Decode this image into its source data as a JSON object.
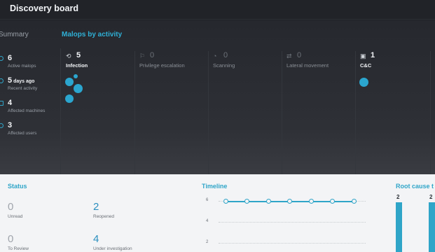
{
  "app": {
    "title": "Discovery board"
  },
  "summary": {
    "title": "Summary",
    "items": [
      {
        "value": "6",
        "suffix": "",
        "label": "Active malops",
        "icon": "malop-icon"
      },
      {
        "value": "5",
        "suffix": " days ago",
        "label": "Recent activity",
        "icon": "clock-icon"
      },
      {
        "value": "4",
        "suffix": "",
        "label": "Affected machines",
        "icon": "machine-icon"
      },
      {
        "value": "3",
        "suffix": "",
        "label": "Affected users",
        "icon": "user-icon"
      }
    ]
  },
  "malops": {
    "title": "Malops by activity",
    "categories": [
      {
        "count": "5",
        "label": "Infection",
        "icon": "infection-icon",
        "active": true
      },
      {
        "count": "0",
        "label": "Privilege escalation",
        "icon": "privilege-icon",
        "active": false
      },
      {
        "count": "0",
        "label": "Scanning",
        "icon": "scanning-icon",
        "active": false
      },
      {
        "count": "0",
        "label": "Lateral movement",
        "icon": "lateral-movement-icon",
        "active": false
      },
      {
        "count": "1",
        "label": "C&C",
        "icon": "cnc-icon",
        "active": true
      }
    ]
  },
  "status": {
    "title": "Status",
    "items": [
      {
        "value": "0",
        "label": "Unread"
      },
      {
        "value": "2",
        "label": "Reopened"
      },
      {
        "value": "0",
        "label": "To Review"
      },
      {
        "value": "4",
        "label": "Under investigation"
      }
    ]
  },
  "timeline": {
    "title": "Timeline",
    "y_ticks": [
      "6",
      "4",
      "2"
    ],
    "points": [
      6,
      6,
      6,
      6,
      6,
      6,
      6
    ]
  },
  "root_cause": {
    "title": "Root cause t",
    "values": [
      "2",
      "2"
    ]
  },
  "colors": {
    "accent": "#2fa5c8",
    "bubble": "#2ba6cf",
    "dark_bg": "#26282e",
    "light_bg": "#f3f4f6"
  }
}
